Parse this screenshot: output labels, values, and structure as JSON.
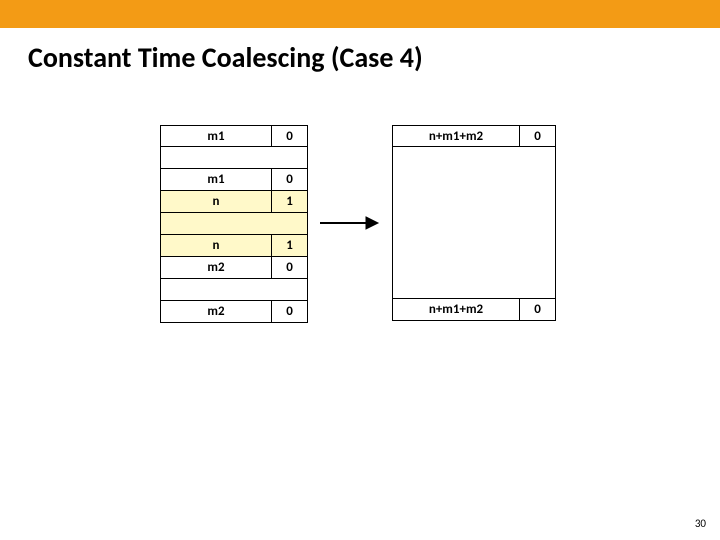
{
  "slide": {
    "title": "Constant Time Coalescing (Case 4)",
    "page_number": "30"
  },
  "left": {
    "r0": {
      "size": "m1",
      "flag": "0"
    },
    "r1": {
      "size": "m1",
      "flag": "0"
    },
    "r2": {
      "size": "n",
      "flag": "1"
    },
    "r3": {
      "size": "n",
      "flag": "1"
    },
    "r4": {
      "size": "m2",
      "flag": "0"
    },
    "r5": {
      "size": "m2",
      "flag": "0"
    }
  },
  "right": {
    "top": {
      "size": "n+m1+m2",
      "flag": "0"
    },
    "bottom": {
      "size": "n+m1+m2",
      "flag": "0"
    }
  }
}
